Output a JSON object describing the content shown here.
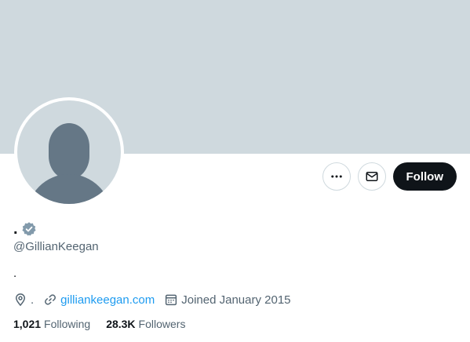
{
  "profile": {
    "display_name": ".",
    "handle": "@GillianKeegan",
    "bio": ".",
    "location": ".",
    "website": "gilliankeegan.com",
    "joined": "Joined January 2015",
    "verified_badge_icon": "verified-badge-icon",
    "colors": {
      "banner": "#cfd9de",
      "avatar_fg": "#657786",
      "link": "#1d9bf0",
      "follow_bg": "#0f1419",
      "secondary_text": "#536471",
      "badge": "#829aab"
    }
  },
  "actions": {
    "more_icon": "more-horizontal-icon",
    "message_icon": "envelope-icon",
    "follow_label": "Follow"
  },
  "stats": {
    "following_count": "1,021",
    "following_label": "Following",
    "followers_count": "28.3K",
    "followers_label": "Followers"
  }
}
